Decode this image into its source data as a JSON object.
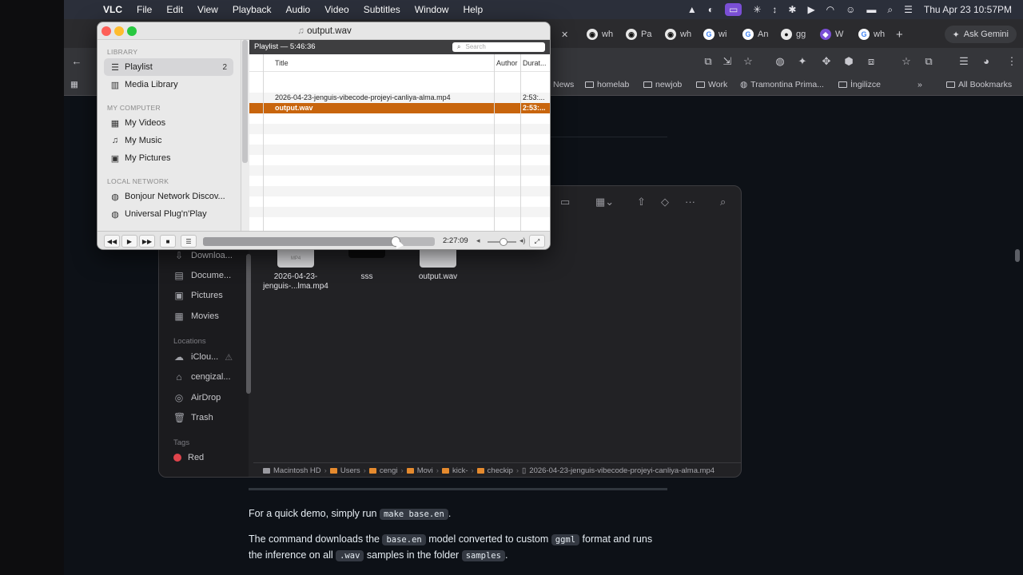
{
  "menubar": {
    "app": "VLC",
    "items": [
      "File",
      "Edit",
      "View",
      "Playback",
      "Audio",
      "Video",
      "Subtitles",
      "Window",
      "Help"
    ],
    "datetime": "Thu Apr 23  10:57PM"
  },
  "browser": {
    "tabs": [
      {
        "fav": "gh",
        "label": "wh"
      },
      {
        "fav": "gh",
        "label": "Pa"
      },
      {
        "fav": "gh",
        "label": "wh"
      },
      {
        "fav": "g",
        "label": "wi"
      },
      {
        "fav": "g",
        "label": "An"
      },
      {
        "fav": "o",
        "label": "gg"
      },
      {
        "fav": "p",
        "label": "W"
      },
      {
        "fav": "g",
        "label": "wh"
      }
    ],
    "new_tab": "+",
    "ask_gemini": "Ask Gemini",
    "bookmarks": [
      "News",
      "homelab",
      "newjob",
      "Work",
      "Tramontina Prima...",
      "İngilizce"
    ],
    "bookmarks_more": "»",
    "all_bookmarks": "All Bookmarks",
    "doc": {
      "p1_a": "For a quick demo, simply run ",
      "p1_code": "make base.en",
      "p1_b": ".",
      "p2_a": "The command downloads the ",
      "p2_code1": "base.en",
      "p2_b": " model converted to custom ",
      "p2_code2": "ggml",
      "p2_c": " format and runs",
      "p3_a": "the inference on all ",
      "p3_code1": ".wav",
      "p3_b": " samples in the folder ",
      "p3_code2": "samples",
      "p3_c": "."
    }
  },
  "finder": {
    "sidebar": [
      {
        "icon": "download-icon",
        "glyph": "⇩",
        "label": "Downloa..."
      },
      {
        "icon": "document-icon",
        "glyph": "▤",
        "label": "Docume..."
      },
      {
        "icon": "pictures-icon",
        "glyph": "▣",
        "label": "Pictures"
      },
      {
        "icon": "movies-icon",
        "glyph": "▦",
        "label": "Movies"
      }
    ],
    "locations_header": "Locations",
    "locations": [
      {
        "icon": "cloud-icon",
        "glyph": "☁",
        "label": "iClou..."
      },
      {
        "icon": "home-icon",
        "glyph": "⌂",
        "label": "cengizal..."
      },
      {
        "icon": "airdrop-icon",
        "glyph": "◎",
        "label": "AirDrop"
      },
      {
        "icon": "trash-icon",
        "glyph": "🗑",
        "label": "Trash"
      }
    ],
    "tags_header": "Tags",
    "tag_red": "Red",
    "files": [
      {
        "name": "2026-04-23-\njenguis-...lma.mp4"
      },
      {
        "name": "sss"
      },
      {
        "name": "output.wav"
      }
    ],
    "file_badge": "MP4",
    "path": [
      "Macintosh HD",
      "Users",
      "cengi",
      "Movi",
      "kick-",
      "checkip",
      "2026-04-23-jenguis-vibecode-projeyi-canliya-alma.mp4"
    ]
  },
  "vlc": {
    "window_title": "output.wav",
    "library_header": "LIBRARY",
    "playlist_label": "Playlist",
    "playlist_count": "2",
    "media_library": "Media Library",
    "computer_header": "MY COMPUTER",
    "my_videos": "My Videos",
    "my_music": "My Music",
    "my_pictures": "My Pictures",
    "network_header": "LOCAL NETWORK",
    "bonjour": "Bonjour Network Discov...",
    "upnp": "Universal Plug'n'Play",
    "playlist_header": "Playlist — 5:46:36",
    "search_placeholder": "Search",
    "col_title": "Title",
    "col_author": "Author",
    "col_duration": "Durat...",
    "rows": [
      {
        "title": "2026-04-23-jenguis-vibecode-projeyi-canliya-alma.mp4",
        "author": "",
        "duration": "2:53:..."
      },
      {
        "title": "output.wav",
        "author": "",
        "duration": "2:53:..."
      }
    ],
    "elapsed": "2:27:09",
    "seek_progress": 0.83,
    "volume": 0.55
  }
}
